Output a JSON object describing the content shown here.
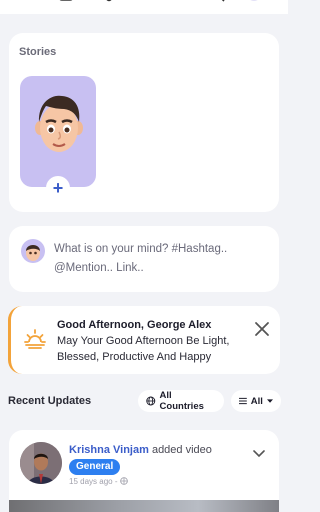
{
  "nav": {
    "icons": [
      "menu-icon",
      "home-icon",
      "friends-icon",
      "messages-icon",
      "notifications-icon",
      "search-icon"
    ]
  },
  "stories": {
    "title": "Stories",
    "add_symbol": "+"
  },
  "composer": {
    "placeholder": "What is on your mind? #Hashtag.. @Mention.. Link.."
  },
  "greeting": {
    "title": "Good Afternoon, George Alex",
    "message": "May Your Good Afternoon Be Light, Blessed, Productive And Happy",
    "accent_color": "#f3a33a"
  },
  "recent": {
    "label": "Recent Updates",
    "country_filter": "All Countries",
    "type_filter": "All"
  },
  "post": {
    "author": "Krishna Vinjam",
    "action": " added video",
    "badge": "General",
    "time": "15 days ago -",
    "link_color": "#3b5dc9",
    "badge_color": "#2d7ff0"
  }
}
